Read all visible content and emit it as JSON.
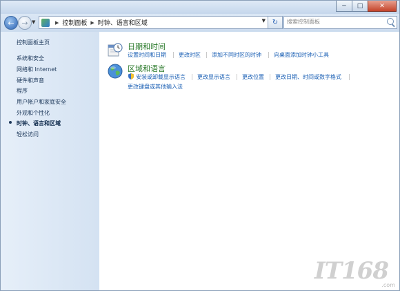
{
  "window": {
    "controls": {
      "minimize": "─",
      "maximize": "□",
      "close": "✕"
    }
  },
  "nav": {
    "back_glyph": "←",
    "forward_glyph": "→",
    "history_glyph": "▼",
    "refresh_glyph": "↻",
    "breadcrumb": [
      "控制面板",
      "时钟、语言和区域"
    ],
    "search_placeholder": "搜索控制面板"
  },
  "sidebar": {
    "home": "控制面板主页",
    "items": [
      "系统和安全",
      "网络和 Internet",
      "硬件和声音",
      "程序",
      "用户帐户和家庭安全",
      "外观和个性化",
      "时钟、语言和区域",
      "轻松访问"
    ],
    "current_index": 6
  },
  "categories": [
    {
      "title": "日期和时间",
      "links": [
        "设置时间和日期",
        "更改时区",
        "添加不同时区的时钟",
        "向桌面添加时钟小工具"
      ]
    },
    {
      "title": "区域和语言",
      "links": [
        "安装或卸载显示语言",
        "更改显示语言",
        "更改位置",
        "更改日期、时间或数字格式",
        "更改键盘或其他输入法"
      ]
    }
  ],
  "watermark": {
    "logo": "IT168",
    "sub": ".com"
  },
  "colors": {
    "link": "#1a5fb4",
    "category_title": "#2b7a2b",
    "sidebar_bg": "#dce8f5"
  }
}
